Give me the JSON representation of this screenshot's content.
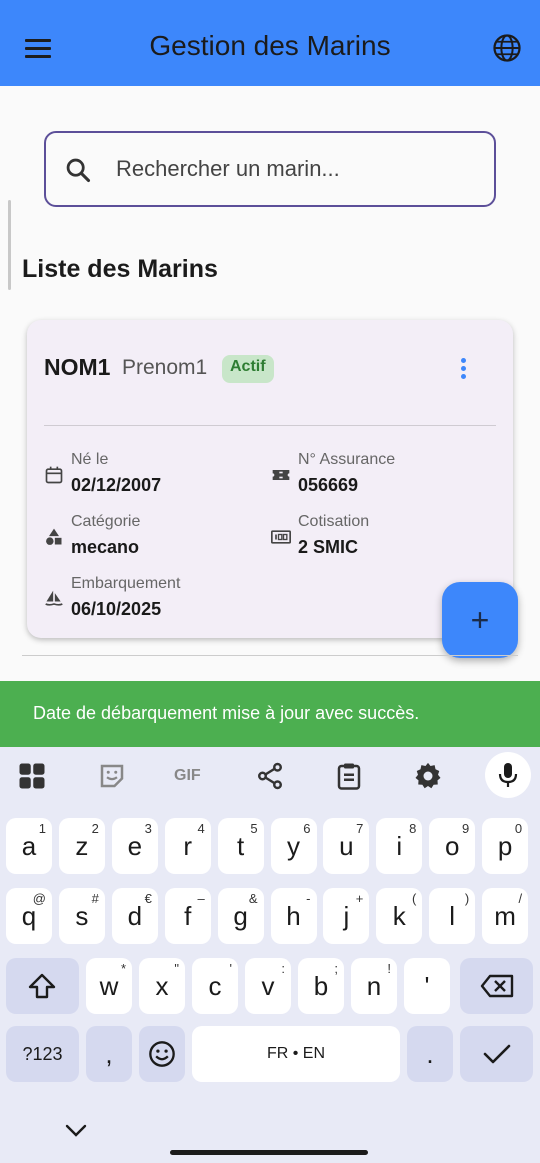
{
  "appbar": {
    "title": "Gestion des Marins"
  },
  "search": {
    "placeholder": "Rechercher un marin..."
  },
  "section_title": "Liste des Marins",
  "card": {
    "nom": "NOM1",
    "prenom": "Prenom1",
    "status": "Actif",
    "fields": {
      "naissance": {
        "label": "Né le",
        "value": "02/12/2007"
      },
      "assurance": {
        "label": "N° Assurance",
        "value": "056669"
      },
      "categorie": {
        "label": "Catégorie",
        "value": "mecano"
      },
      "cotisation": {
        "label": "Cotisation",
        "value": "2 SMIC"
      },
      "embarquement": {
        "label": "Embarquement",
        "value": "06/10/2025"
      }
    }
  },
  "fab": {
    "label": "+"
  },
  "snackbar": {
    "message": "Date de débarquement mise à jour avec succès."
  },
  "keyboard": {
    "toolbar": {
      "gif_label": "GIF"
    },
    "row1": [
      {
        "k": "a",
        "s": "1"
      },
      {
        "k": "z",
        "s": "2"
      },
      {
        "k": "e",
        "s": "3"
      },
      {
        "k": "r",
        "s": "4"
      },
      {
        "k": "t",
        "s": "5"
      },
      {
        "k": "y",
        "s": "6"
      },
      {
        "k": "u",
        "s": "7"
      },
      {
        "k": "i",
        "s": "8"
      },
      {
        "k": "o",
        "s": "9"
      },
      {
        "k": "p",
        "s": "0"
      }
    ],
    "row2": [
      {
        "k": "q",
        "s": "@"
      },
      {
        "k": "s",
        "s": "#"
      },
      {
        "k": "d",
        "s": "€"
      },
      {
        "k": "f",
        "s": "–"
      },
      {
        "k": "g",
        "s": "&"
      },
      {
        "k": "h",
        "s": "-"
      },
      {
        "k": "j",
        "s": "+"
      },
      {
        "k": "k",
        "s": "("
      },
      {
        "k": "l",
        "s": ")"
      },
      {
        "k": "m",
        "s": "/"
      }
    ],
    "row3": [
      {
        "k": "w",
        "s": "*"
      },
      {
        "k": "x",
        "s": "\""
      },
      {
        "k": "c",
        "s": "'"
      },
      {
        "k": "v",
        "s": ":"
      },
      {
        "k": "b",
        "s": ";"
      },
      {
        "k": "n",
        "s": "!"
      },
      {
        "k": "'",
        "s": ""
      }
    ],
    "symbols_label": "?123",
    "comma_label": ",",
    "space_label": "FR • EN",
    "period_label": "."
  }
}
